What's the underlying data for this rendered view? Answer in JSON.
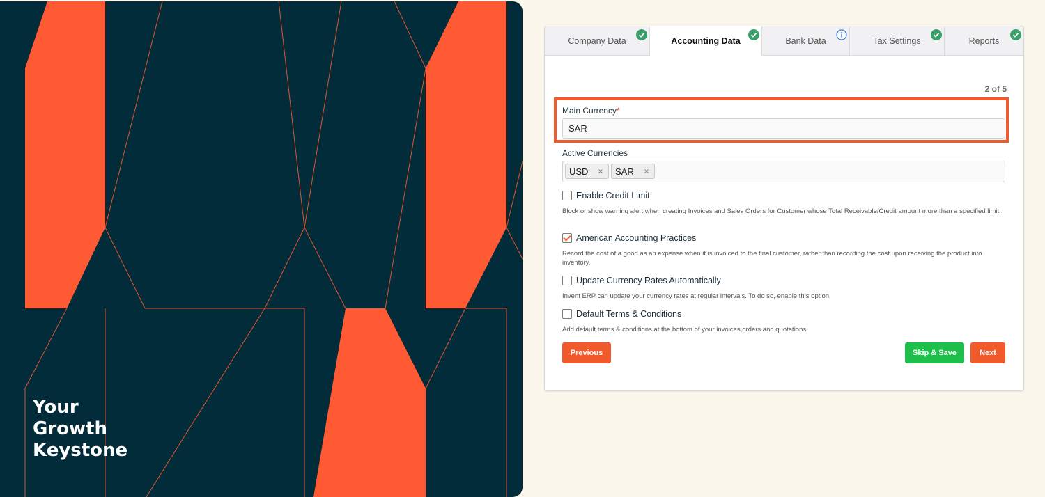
{
  "hero": {
    "tagline": [
      "Your",
      "Growth",
      "Keystone"
    ],
    "colors": {
      "background": "#022c39",
      "accent": "#ff5a33",
      "line": "#e0542b"
    }
  },
  "tabs": [
    {
      "label": "Company Data",
      "status": "check-icon"
    },
    {
      "label": "Accounting Data",
      "status": "check-icon",
      "active": true
    },
    {
      "label": "Bank Data",
      "status": "info-icon"
    },
    {
      "label": "Tax Settings",
      "status": "check-icon"
    },
    {
      "label": "Reports",
      "status": "check-icon"
    }
  ],
  "step": "2 of 5",
  "main_currency": {
    "label": "Main Currency",
    "required": "*",
    "value": "SAR"
  },
  "active_currencies": {
    "label": "Active Currencies",
    "chips": [
      "USD",
      "SAR"
    ],
    "remove": "×"
  },
  "options": [
    {
      "label": "Enable Credit Limit",
      "checked": false,
      "description": "Block or show warning alert when creating Invoices and Sales Orders for Customer whose Total Receivable/Credit amount more than a specified limit."
    },
    {
      "label": "American Accounting Practices",
      "checked": true,
      "description": "Record the cost of a good as an expense when it is invoiced to the final customer, rather than recording the cost upon receiving the product into inventory."
    },
    {
      "label": "Update Currency Rates Automatically",
      "checked": false,
      "description": "Invent ERP can update your currency rates at regular intervals. To do so, enable this option."
    },
    {
      "label": "Default Terms & Conditions",
      "checked": false,
      "description": "Add default terms & conditions at the bottom of your invoices,orders and quotations."
    }
  ],
  "buttons": {
    "previous": "Previous",
    "skip_save": "Skip & Save",
    "next": "Next"
  },
  "colors": {
    "accent": "#f15a2b",
    "success": "#1fbf4b",
    "check_badge": "#3aa06a",
    "info_badge": "#3b7ddd"
  }
}
